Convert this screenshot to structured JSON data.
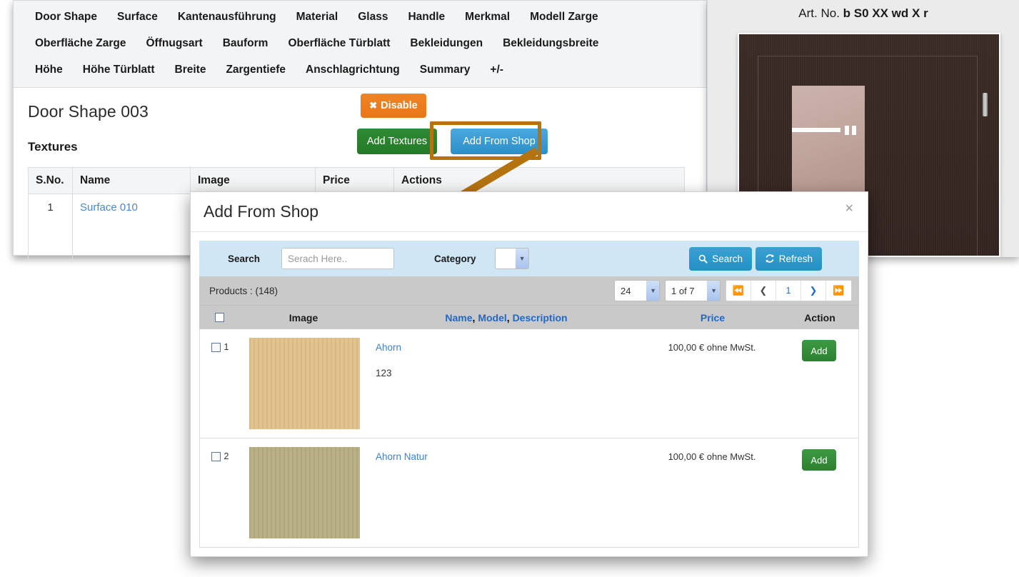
{
  "background_page": {
    "tab_rows": [
      [
        "Door Shape",
        "Surface",
        "Kantenausführung",
        "Material",
        "Glass",
        "Handle",
        "Merkmal",
        "Modell Zarge"
      ],
      [
        "Oberfläche Zarge",
        "Öffnugsart",
        "Bauform",
        "Oberfläche Türblatt",
        "Bekleidungen",
        "Bekleidungsbreite"
      ],
      [
        "Höhe",
        "Höhe Türblatt",
        "Breite",
        "Zargentiefe",
        "Anschlagrichtung",
        "Summary",
        "+/-"
      ]
    ],
    "page_title": "Door Shape 003",
    "section_title": "Textures",
    "disable_button": "Disable",
    "disable_icon": "close-x-icon",
    "add_textures_button": "Add Textures",
    "add_from_shop_button": "Add From Shop",
    "table": {
      "columns": [
        "S.No.",
        "Name",
        "Image",
        "Price",
        "Actions"
      ],
      "rows": [
        {
          "sno": "1",
          "name": "Surface 010",
          "image": "",
          "price": "",
          "actions": ""
        }
      ]
    }
  },
  "preview": {
    "art_no_label": "Art. No.",
    "art_no_value": "b S0 XX wd X r",
    "door_color": "#332420",
    "panel_color": "#c2a79f"
  },
  "annotation": {
    "color": "#b5730f",
    "target": "add-from-shop-button"
  },
  "modal": {
    "title": "Add From Shop",
    "close_icon": "close-icon",
    "close_label": "×",
    "search": {
      "search_label": "Search",
      "search_placeholder": "Serach Here..",
      "search_value": "",
      "category_label": "Category",
      "category_value": "",
      "search_button": "Search",
      "search_icon": "magnifier-icon",
      "refresh_button": "Refresh",
      "refresh_icon": "refresh-icon"
    },
    "pager": {
      "products_count_label": "Products : (148)",
      "per_page_value": "24",
      "page_of_value": "1 of 7",
      "first_icon": "double-left-icon",
      "prev_icon": "chevron-left-icon",
      "current_page": "1",
      "next_icon": "chevron-right-icon",
      "last_icon": "double-right-icon"
    },
    "results": {
      "columns": {
        "checkbox": "",
        "image": "Image",
        "name": "Name",
        "comma1": ",",
        "model": "Model",
        "comma2": ",",
        "description": "Description",
        "price": "Price",
        "action": "Action"
      },
      "rows": [
        {
          "num": "1",
          "name": "Ahorn",
          "model": "123",
          "price": "100,00 € ohne MwSt.",
          "action": "Add",
          "thumb_color": "#e0c08a"
        },
        {
          "num": "2",
          "name": "Ahorn Natur",
          "model": "",
          "price": "100,00 € ohne MwSt.",
          "action": "Add",
          "thumb_color": "#b5ac80"
        }
      ]
    }
  }
}
